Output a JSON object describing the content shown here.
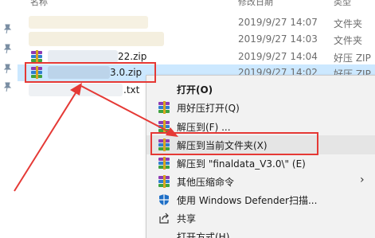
{
  "header": {
    "name_col": "名称",
    "date_col": "修改日期",
    "type_col": "类型"
  },
  "files": [
    {
      "name": "",
      "date": "2019/9/27 14:07",
      "type": "文件夹"
    },
    {
      "name": "",
      "date": "2019/9/27 14:03",
      "type": "文件夹"
    },
    {
      "name": "22.zip",
      "date": "2019/9/27 14:04",
      "type": "好压 ZIP"
    },
    {
      "name": "3.0.zip",
      "date": "2019/9/27 14:02",
      "type": "好压 ZIP"
    },
    {
      "name": ".txt",
      "date": "",
      "type": ""
    }
  ],
  "context_menu": {
    "items": [
      {
        "label": "打开(O)",
        "icon": "none"
      },
      {
        "label": "用好压打开(Q)",
        "icon": "rar-icon"
      },
      {
        "label": "解压到(F) ...",
        "icon": "rar-icon"
      },
      {
        "label": "解压到当前文件夹(X)",
        "icon": "rar-icon"
      },
      {
        "label": "解压到 \"finaldata_V3.0\\\" (E)",
        "icon": "rar-icon"
      },
      {
        "label": "其他压缩命令",
        "icon": "rar-icon",
        "submenu": true
      },
      {
        "label": "使用 Windows Defender扫描...",
        "icon": "shield-icon"
      },
      {
        "label": "共享",
        "icon": "share-icon"
      },
      {
        "label": "打开方式(H)",
        "icon": "none"
      }
    ]
  },
  "colors": {
    "highlight_red": "#e53935",
    "selection_blue": "#cce8ff",
    "menu_bg": "#f2f2f2"
  }
}
